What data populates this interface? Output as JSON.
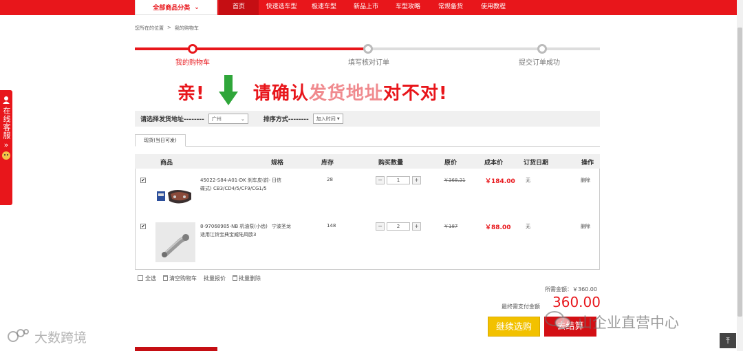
{
  "nav": {
    "category": "全部商品分类",
    "items": [
      "首页",
      "快速选车型",
      "极速车型",
      "新品上市",
      "车型攻略",
      "常规备货",
      "使用教程"
    ],
    "active_index": 0
  },
  "breadcrumb": {
    "prefix": "您所在的位置",
    "separator": ">",
    "current": "我的购物车"
  },
  "progress": {
    "steps": [
      "我的购物车",
      "填写核对订单",
      "提交订单成功"
    ],
    "active_step": 1
  },
  "banner": {
    "part1": "亲!",
    "part2": "请确认",
    "part3": "发货地址",
    "part4": "对不对!"
  },
  "filters": {
    "address_label": "请选择发货地址--------",
    "address_value": "广州",
    "sort_label": "排序方式--------",
    "sort_value": "加入时间"
  },
  "tab": {
    "label": "现货(当日可发)"
  },
  "table": {
    "headers": [
      "商品",
      "规格",
      "库存",
      "购买数量",
      "原价",
      "成本价",
      "订货日期",
      "操作"
    ],
    "rows": [
      {
        "checked": true,
        "name_line1": "45022-S84-A01-DK 刹车皮(前-",
        "name_line2": "碟式) CB3/CD4/5/CF9/CG1/5",
        "spec": "日信",
        "stock": "28",
        "qty": "1",
        "orig_price": "￥368.21",
        "cost_price": "￥184.00",
        "order_date": "无",
        "action": "删除"
      },
      {
        "checked": true,
        "name_line1": "8-97068985-NB 机油泵(小齿)",
        "name_line2": "适用江铃宝典宝威陆风欧3",
        "spec": "宁波圣龙",
        "stock": "148",
        "qty": "2",
        "orig_price": "￥187",
        "cost_price": "￥88.00",
        "order_date": "无",
        "action": "删除"
      }
    ]
  },
  "batch": {
    "select_all": "全选",
    "clear_cart": "清空购物车",
    "batch_quote": "批量报价",
    "batch_delete": "批量删除"
  },
  "totals": {
    "required_label": "所需金额：",
    "required_value": "￥360.00",
    "final_label": "最终需支付金额",
    "final_value": "360.00"
  },
  "buttons": {
    "continue": "继续选购",
    "checkout": "去结算"
  },
  "side": {
    "service": "在线客服",
    "chevron": "»"
  },
  "watermarks": {
    "left": "大数跨境",
    "right": "山企业直营中心"
  },
  "colors": {
    "brand_red": "#e8161b",
    "yellow": "#f2c100"
  }
}
